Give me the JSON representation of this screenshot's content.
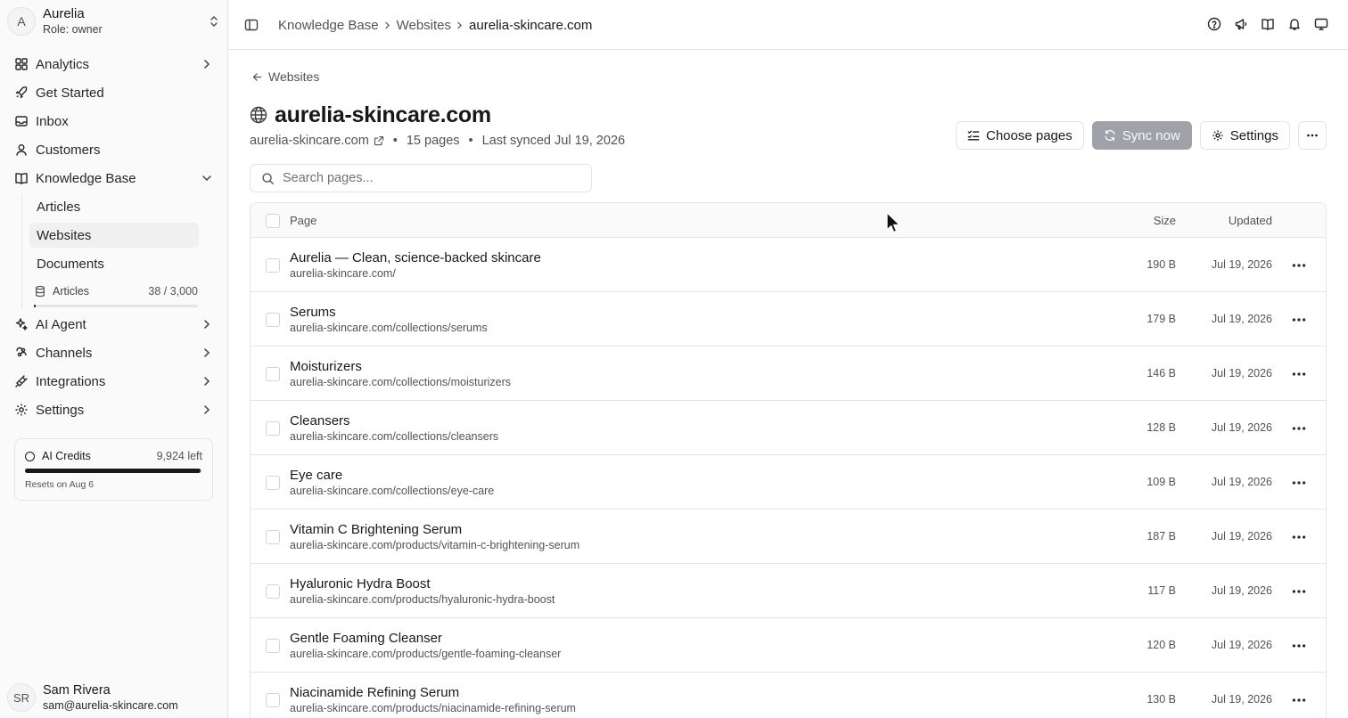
{
  "workspace": {
    "initial": "A",
    "name": "Aurelia",
    "role": "Role: owner"
  },
  "nav": {
    "analytics": "Analytics",
    "get_started": "Get Started",
    "inbox": "Inbox",
    "customers": "Customers",
    "knowledge_base": "Knowledge Base",
    "sub": {
      "articles": "Articles",
      "websites": "Websites",
      "documents": "Documents"
    },
    "quota": {
      "label": "Articles",
      "count": "38 / 3,000",
      "fraction": 0.0127
    },
    "ai_agent": "AI Agent",
    "channels": "Channels",
    "integrations": "Integrations",
    "settings": "Settings"
  },
  "credits": {
    "label": "AI Credits",
    "left": "9,924 left",
    "reset": "Resets on Aug 6",
    "fraction": 0.99
  },
  "user": {
    "initials": "SR",
    "name": "Sam Rivera",
    "email": "sam@aurelia-skincare.com"
  },
  "breadcrumb": {
    "item1": "Knowledge Base",
    "item2": "Websites",
    "current": "aurelia-skincare.com"
  },
  "main": {
    "back_label": "Websites",
    "title": "aurelia-skincare.com",
    "meta": {
      "domain": "aurelia-skincare.com",
      "pages": "15 pages",
      "synced": "Last synced Jul 19, 2026"
    },
    "actions": {
      "choose_pages": "Choose pages",
      "sync_now": "Sync now",
      "settings": "Settings"
    },
    "search": {
      "placeholder": "Search pages..."
    },
    "table": {
      "headers": {
        "page": "Page",
        "size": "Size",
        "updated": "Updated"
      },
      "rows": [
        {
          "title": "Aurelia — Clean, science-backed skincare",
          "url": "aurelia-skincare.com/",
          "size": "190 B",
          "updated": "Jul 19, 2026"
        },
        {
          "title": "Serums",
          "url": "aurelia-skincare.com/collections/serums",
          "size": "179 B",
          "updated": "Jul 19, 2026"
        },
        {
          "title": "Moisturizers",
          "url": "aurelia-skincare.com/collections/moisturizers",
          "size": "146 B",
          "updated": "Jul 19, 2026"
        },
        {
          "title": "Cleansers",
          "url": "aurelia-skincare.com/collections/cleansers",
          "size": "128 B",
          "updated": "Jul 19, 2026"
        },
        {
          "title": "Eye care",
          "url": "aurelia-skincare.com/collections/eye-care",
          "size": "109 B",
          "updated": "Jul 19, 2026"
        },
        {
          "title": "Vitamin C Brightening Serum",
          "url": "aurelia-skincare.com/products/vitamin-c-brightening-serum",
          "size": "187 B",
          "updated": "Jul 19, 2026"
        },
        {
          "title": "Hyaluronic Hydra Boost",
          "url": "aurelia-skincare.com/products/hyaluronic-hydra-boost",
          "size": "117 B",
          "updated": "Jul 19, 2026"
        },
        {
          "title": "Gentle Foaming Cleanser",
          "url": "aurelia-skincare.com/products/gentle-foaming-cleanser",
          "size": "120 B",
          "updated": "Jul 19, 2026"
        },
        {
          "title": "Niacinamide Refining Serum",
          "url": "aurelia-skincare.com/products/niacinamide-refining-serum",
          "size": "130 B",
          "updated": "Jul 19, 2026"
        }
      ]
    }
  },
  "icons": {
    "nav": [
      "grid-icon",
      "rocket-icon",
      "inbox-icon",
      "user-icon",
      "book-icon",
      "database-icon",
      "sparkle-icon",
      "channels-icon",
      "plug-icon",
      "gear-icon"
    ],
    "topbar": [
      "help-circle-icon",
      "megaphone-icon",
      "book-open-icon",
      "bell-icon",
      "monitor-icon"
    ]
  },
  "colors": {
    "accent": "#18181b",
    "sync_button_bg": "#a1a1aa",
    "border": "#e4e4e7",
    "sidebar_bg": "#fafafa"
  }
}
